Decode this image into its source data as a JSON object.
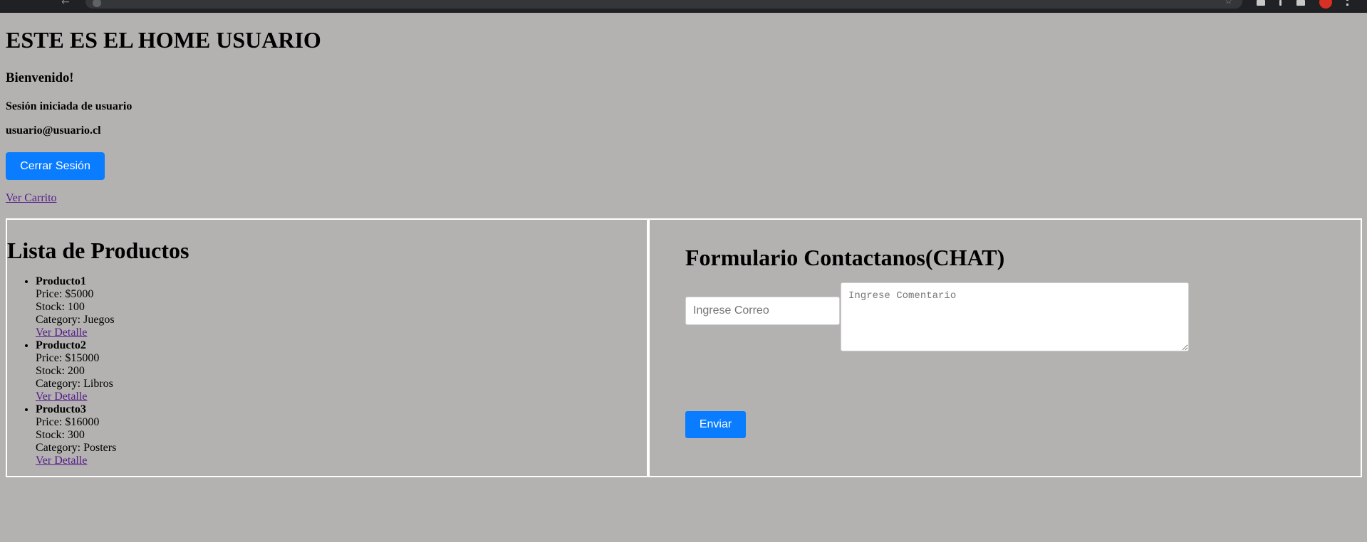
{
  "browser": {
    "back_icon": "←",
    "bookmark_icon": "☆"
  },
  "header": {
    "title": "ESTE ES EL HOME USUARIO",
    "welcome": "Bienvenido!",
    "session_label": "Sesión iniciada de usuario",
    "user_email": "usuario@usuario.cl",
    "logout_label": "Cerrar Sesión",
    "cart_link": "Ver Carrito"
  },
  "products": {
    "title": "Lista de Productos",
    "items": [
      {
        "name": "Producto1",
        "price": "Price: $5000",
        "stock": "Stock: 100",
        "category": "Category: Juegos",
        "link": "Ver Detalle"
      },
      {
        "name": "Producto2",
        "price": "Price: $15000",
        "stock": "Stock: 200",
        "category": "Category: Libros",
        "link": "Ver Detalle"
      },
      {
        "name": "Producto3",
        "price": "Price: $16000",
        "stock": "Stock: 300",
        "category": "Category: Posters",
        "link": "Ver Detalle"
      }
    ]
  },
  "contact": {
    "title": "Formulario Contactanos(CHAT)",
    "email_placeholder": "Ingrese Correo",
    "email_value": "",
    "comment_placeholder": "Ingrese Comentario",
    "comment_value": "",
    "send_label": "Enviar"
  },
  "colors": {
    "background": "#b3b2b0",
    "button": "#0a7cff",
    "link": "#551a8b",
    "panel_border": "#ffffff"
  }
}
